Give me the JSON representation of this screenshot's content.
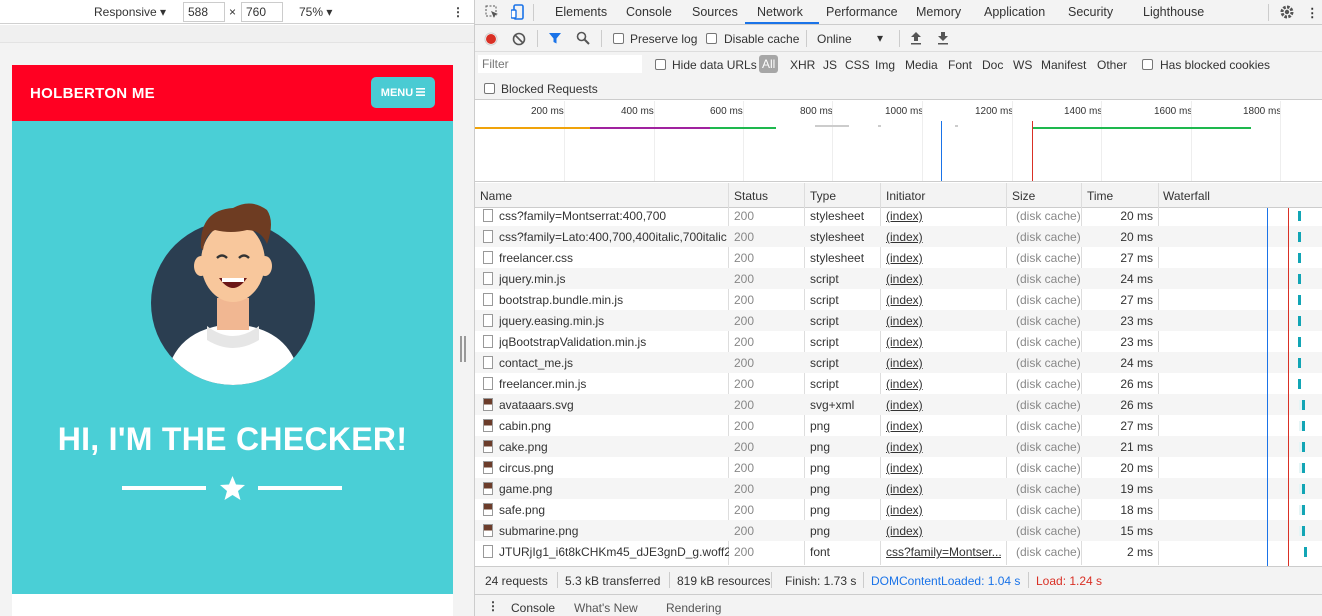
{
  "device_toolbar": {
    "device": "Responsive",
    "width": "588",
    "times": "×",
    "height": "760",
    "zoom": "75%"
  },
  "viewport": {
    "brand": "HOLBERTON ME",
    "menu_label": "MENU",
    "heading": "HI, I'M THE CHECKER!"
  },
  "devtools": {
    "tabs": [
      "Elements",
      "Console",
      "Sources",
      "Network",
      "Performance",
      "Memory",
      "Application",
      "Security",
      "Lighthouse"
    ],
    "active_tab": "Network",
    "toolbar": {
      "preserve_log": "Preserve log",
      "disable_cache": "Disable cache",
      "throttle": "Online"
    },
    "filter": {
      "placeholder": "Filter",
      "hide_data_urls": "Hide data URLs",
      "types": [
        "All",
        "XHR",
        "JS",
        "CSS",
        "Img",
        "Media",
        "Font",
        "Doc",
        "WS",
        "Manifest",
        "Other"
      ],
      "has_blocked_cookies": "Has blocked cookies",
      "blocked_requests": "Blocked Requests"
    },
    "overview_ticks": [
      "200 ms",
      "400 ms",
      "600 ms",
      "800 ms",
      "1000 ms",
      "1200 ms",
      "1400 ms",
      "1600 ms",
      "1800 ms"
    ],
    "columns": [
      "Name",
      "Status",
      "Type",
      "Initiator",
      "Size",
      "Time",
      "Waterfall"
    ],
    "requests": [
      {
        "name": "css?family=Montserrat:400,700",
        "status": "200",
        "type": "stylesheet",
        "initiator": "(index)",
        "size": "(disk cache)",
        "time": "20 ms",
        "wf": 0.944
      },
      {
        "name": "css?family=Lato:400,700,400italic,700italic",
        "status": "200",
        "type": "stylesheet",
        "initiator": "(index)",
        "size": "(disk cache)",
        "time": "20 ms",
        "wf": 0.944
      },
      {
        "name": "freelancer.css",
        "status": "200",
        "type": "stylesheet",
        "initiator": "(index)",
        "size": "(disk cache)",
        "time": "27 ms",
        "wf": 0.944
      },
      {
        "name": "jquery.min.js",
        "status": "200",
        "type": "script",
        "initiator": "(index)",
        "size": "(disk cache)",
        "time": "24 ms",
        "wf": 0.948
      },
      {
        "name": "bootstrap.bundle.min.js",
        "status": "200",
        "type": "script",
        "initiator": "(index)",
        "size": "(disk cache)",
        "time": "27 ms",
        "wf": 0.948
      },
      {
        "name": "jquery.easing.min.js",
        "status": "200",
        "type": "script",
        "initiator": "(index)",
        "size": "(disk cache)",
        "time": "23 ms",
        "wf": 0.948
      },
      {
        "name": "jqBootstrapValidation.min.js",
        "status": "200",
        "type": "script",
        "initiator": "(index)",
        "size": "(disk cache)",
        "time": "23 ms",
        "wf": 0.948
      },
      {
        "name": "contact_me.js",
        "status": "200",
        "type": "script",
        "initiator": "(index)",
        "size": "(disk cache)",
        "time": "24 ms",
        "wf": 0.948
      },
      {
        "name": "freelancer.min.js",
        "status": "200",
        "type": "script",
        "initiator": "(index)",
        "size": "(disk cache)",
        "time": "26 ms",
        "wf": 0.948
      },
      {
        "name": "avataaars.svg",
        "status": "200",
        "type": "svg+xml",
        "initiator": "(index)",
        "size": "(disk cache)",
        "time": "26 ms",
        "wf": 0.952
      },
      {
        "name": "cabin.png",
        "status": "200",
        "type": "png",
        "initiator": "(index)",
        "size": "(disk cache)",
        "time": "27 ms",
        "wf": 0.952
      },
      {
        "name": "cake.png",
        "status": "200",
        "type": "png",
        "initiator": "(index)",
        "size": "(disk cache)",
        "time": "21 ms",
        "wf": 0.952
      },
      {
        "name": "circus.png",
        "status": "200",
        "type": "png",
        "initiator": "(index)",
        "size": "(disk cache)",
        "time": "20 ms",
        "wf": 0.952
      },
      {
        "name": "game.png",
        "status": "200",
        "type": "png",
        "initiator": "(index)",
        "size": "(disk cache)",
        "time": "19 ms",
        "wf": 0.952
      },
      {
        "name": "safe.png",
        "status": "200",
        "type": "png",
        "initiator": "(index)",
        "size": "(disk cache)",
        "time": "18 ms",
        "wf": 0.952
      },
      {
        "name": "submarine.png",
        "status": "200",
        "type": "png",
        "initiator": "(index)",
        "size": "(disk cache)",
        "time": "15 ms",
        "wf": 0.952
      },
      {
        "name": "JTURjIg1_i6t8kCHKm45_dJE3gnD_g.woff2",
        "status": "200",
        "type": "font",
        "initiator": "css?family=Montser...",
        "size": "(disk cache)",
        "time": "2 ms",
        "wf": 0.985
      }
    ],
    "status": {
      "requests": "24 requests",
      "transferred": "5.3 kB transferred",
      "resources": "819 kB resources",
      "finish": "Finish: 1.73 s",
      "dom_content_loaded": "DOMContentLoaded: 1.04 s",
      "load": "Load: 1.24 s"
    },
    "drawer_tabs": [
      "Console",
      "What's New",
      "Rendering"
    ]
  },
  "colors": {
    "navbar": "#ff0022",
    "hero": "#4acfd6",
    "menu_button": "#4acbd3",
    "dom_loaded": "#1a73e8",
    "load": "#d93025"
  }
}
